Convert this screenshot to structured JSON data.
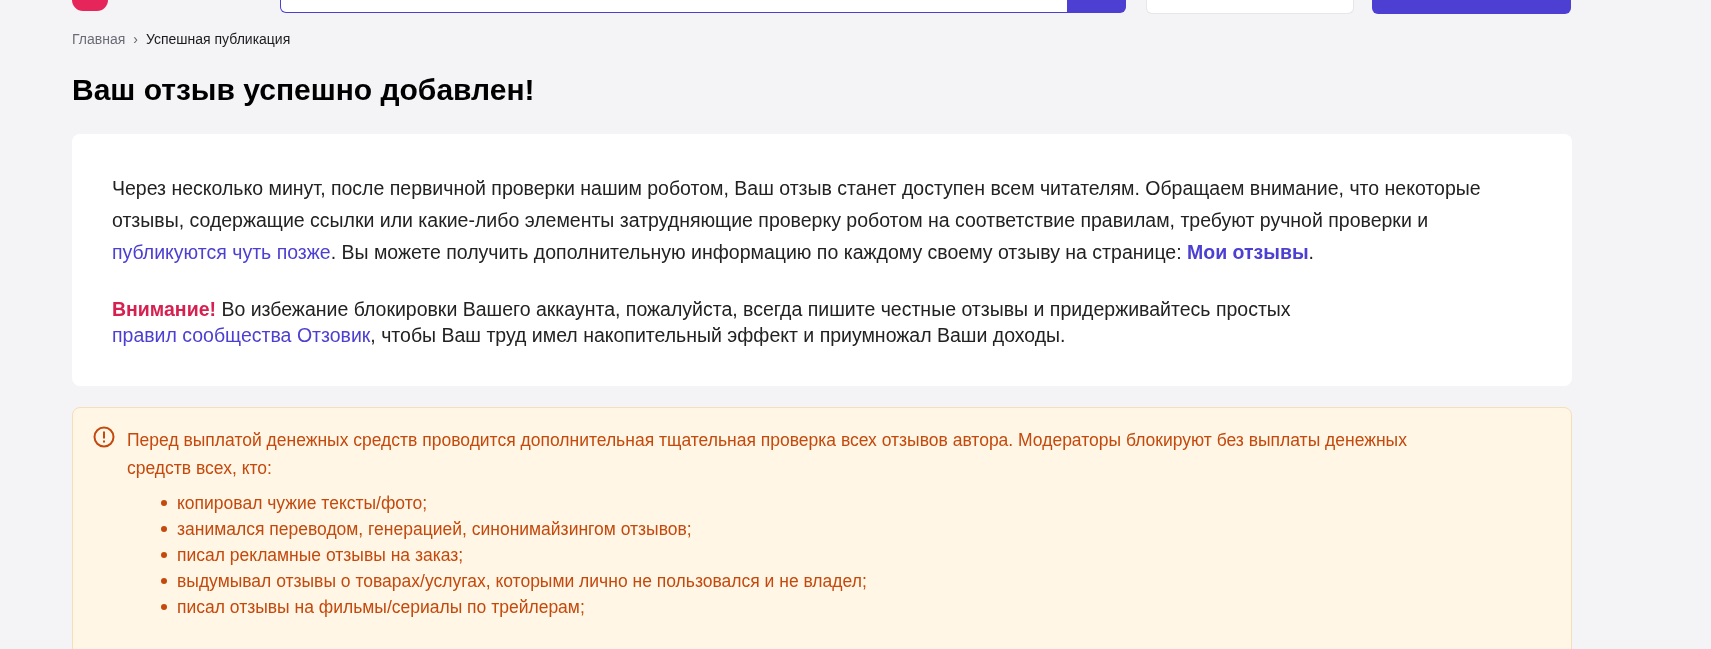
{
  "breadcrumb_separator": "›",
  "breadcrumbs": [
    {
      "label": "Главная",
      "kind": "link"
    },
    {
      "label": "Успешная публикация",
      "kind": "current"
    }
  ],
  "title": "Ваш отзыв успешно добавлен!",
  "notice": {
    "paragraphs": [
      [
        {
          "kind": "text",
          "text": "Через несколько минут, после первичной проверки нашим роботом, Ваш отзыв станет доступен всем читателям. Обращаем внимание, что некоторые отзывы, содержащие ссылки или какие-либо элементы затрудняющие проверку роботом на соответствие правилам, требуют ручной проверки и "
        },
        {
          "kind": "link",
          "text": "публикуются чуть позже"
        },
        {
          "kind": "text",
          "text": ". Вы можете получить дополнительную информацию по каждому своему отзыву на странице: "
        },
        {
          "kind": "strong_link",
          "text": "Мои отзывы"
        },
        {
          "kind": "text",
          "text": "."
        }
      ],
      [
        {
          "kind": "alert",
          "text": "Внимание!"
        },
        {
          "kind": "text",
          "text": " Во избежание блокировки Вашего аккаунта, пожалуйста, всегда пишите честные отзывы и придерживайтесь простых "
        },
        {
          "kind": "link",
          "text": "правил сообщества Отзовик"
        },
        {
          "kind": "text",
          "text": ", чтобы Ваш труд имел накопительный эффект и приумножал Ваши доходы."
        }
      ]
    ]
  },
  "warning": {
    "text": "Перед выплатой денежных средств проводится дополнительная тщательная проверка всех отзывов автора. Модераторы блокируют без выплаты денежных средств всех, кто:",
    "items": [
      "копировал чужие тексты/фото;",
      "занимался переводом, генерацией, синонимайзингом отзывов;",
      "писал рекламные отзывы на заказ;",
      "выдумывал отзывы о товарах/услугах, которыми лично не пользовался и не владел;",
      "писал отзывы на фильмы/сериалы по трейлерам;"
    ]
  }
}
